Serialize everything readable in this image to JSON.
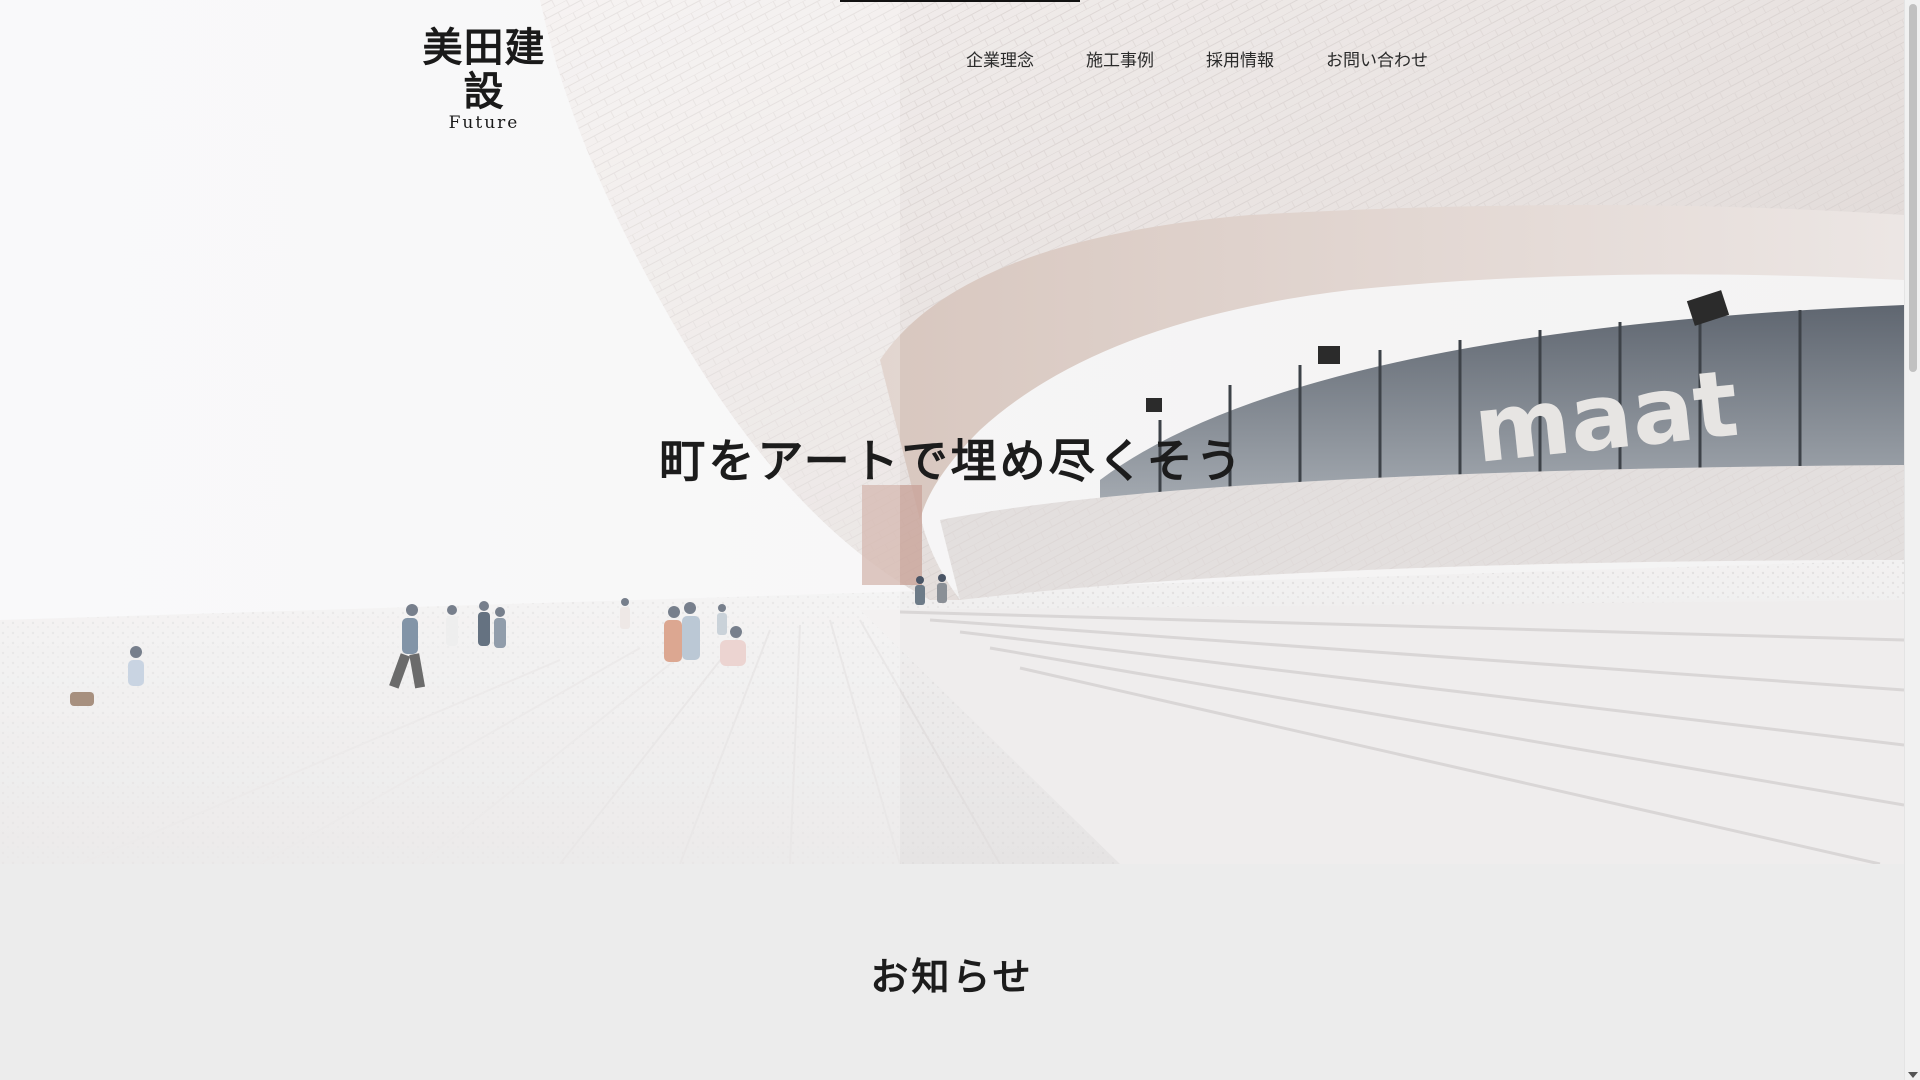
{
  "header": {
    "logo_main": "美田建設",
    "logo_sub": "Future",
    "nav": [
      {
        "label": "企業理念"
      },
      {
        "label": "施工事例"
      },
      {
        "label": "採用情報"
      },
      {
        "label": "お問い合わせ"
      }
    ]
  },
  "hero": {
    "tagline": "町をアートで埋め尽くそう",
    "building_sign": "maat"
  },
  "notice": {
    "title": "お知らせ"
  },
  "colors": {
    "text": "#1c1c1c",
    "section_bg": "#ececec"
  }
}
